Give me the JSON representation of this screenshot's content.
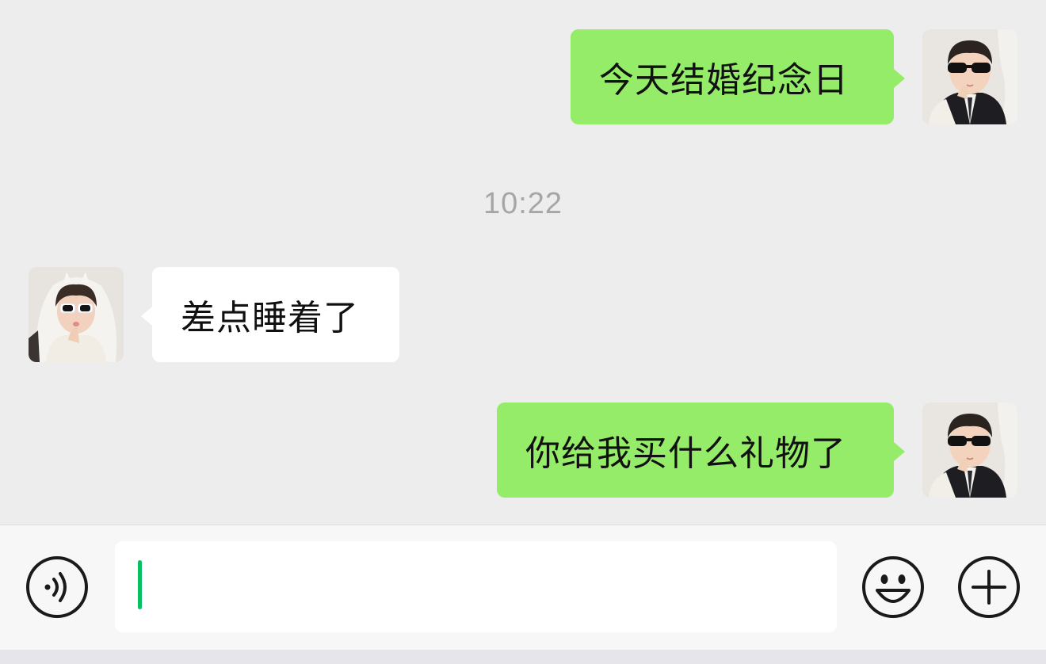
{
  "messages": [
    {
      "side": "sent",
      "text": "今天结婚纪念日",
      "avatar": "boy-sunglasses-avatar"
    },
    {
      "side": "received",
      "text": "差点睡着了",
      "avatar": "girl-sunglasses-avatar"
    },
    {
      "side": "sent",
      "text": "你给我买什么礼物了",
      "avatar": "boy-sunglasses-avatar"
    }
  ],
  "timestamp": "10:22",
  "input": {
    "value": "",
    "caret_color": "#07c160"
  },
  "toolbar": {
    "voice_icon": "voice-icon",
    "emoji_icon": "emoji-icon",
    "more_icon": "plus-icon"
  },
  "colors": {
    "sent_bubble": "#95ec69",
    "received_bubble": "#ffffff",
    "chat_background": "#ededed",
    "timestamp_text": "#a6a6a6"
  }
}
